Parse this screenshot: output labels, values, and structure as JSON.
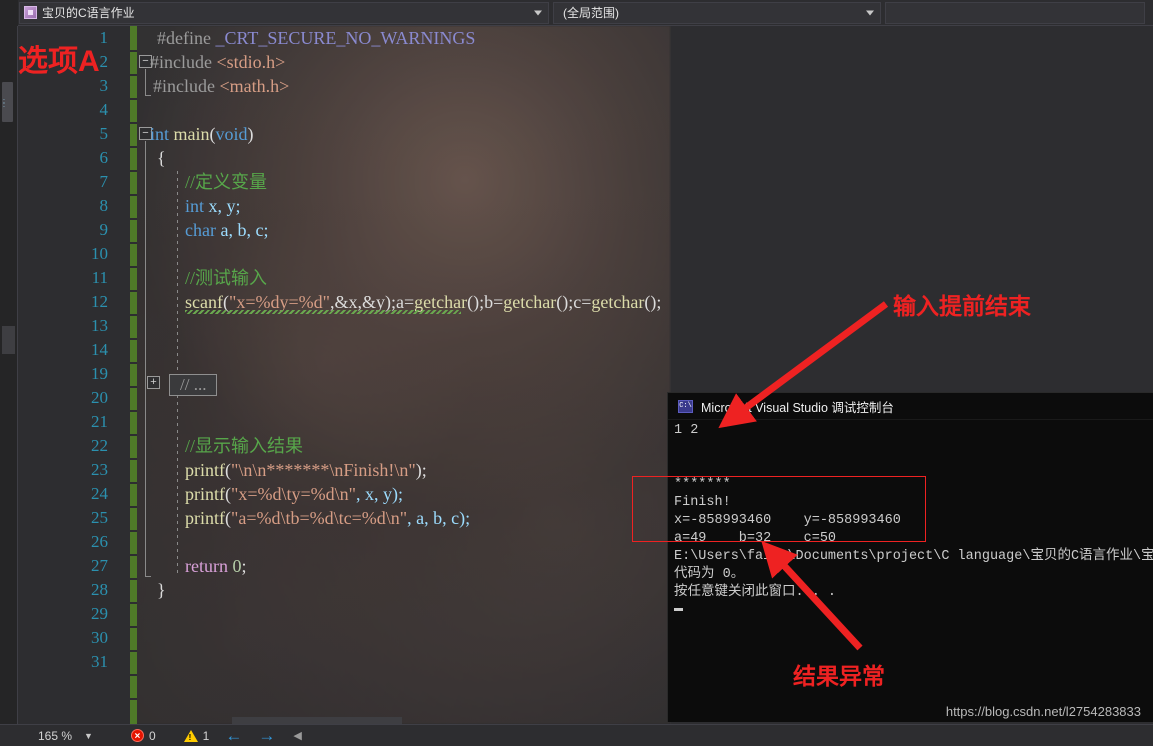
{
  "navbar": {
    "project_combo": {
      "value": "宝贝的C语言作业",
      "icon": "file-icon",
      "arrow": "chevron-down-icon"
    },
    "scope_combo": {
      "value": "(全局范围)",
      "arrow": "chevron-down-icon"
    },
    "third_combo": {
      "value": ""
    }
  },
  "editor": {
    "lines": [
      {
        "num": "1",
        "indent": 0,
        "fold": "none"
      },
      {
        "num": "2",
        "indent": 0,
        "fold": "minus"
      },
      {
        "num": "3",
        "indent": 0,
        "fold": "end"
      },
      {
        "num": "4",
        "indent": 0,
        "fold": "none"
      },
      {
        "num": "5",
        "indent": 0,
        "fold": "minus"
      },
      {
        "num": "6",
        "indent": 0,
        "fold": "none"
      },
      {
        "num": "7",
        "indent": 1,
        "fold": "none"
      },
      {
        "num": "8",
        "indent": 1,
        "fold": "none"
      },
      {
        "num": "9",
        "indent": 1,
        "fold": "none"
      },
      {
        "num": "10",
        "indent": 1,
        "fold": "none"
      },
      {
        "num": "11",
        "indent": 1,
        "fold": "none"
      },
      {
        "num": "12",
        "indent": 1,
        "fold": "none"
      },
      {
        "num": "13",
        "indent": 1,
        "fold": "none"
      },
      {
        "num": "14",
        "indent": 1,
        "fold": "plus"
      },
      {
        "num": "19",
        "indent": 1,
        "fold": "none"
      },
      {
        "num": "20",
        "indent": 1,
        "fold": "none"
      },
      {
        "num": "21",
        "indent": 1,
        "fold": "none"
      },
      {
        "num": "22",
        "indent": 1,
        "fold": "none"
      },
      {
        "num": "23",
        "indent": 1,
        "fold": "none"
      },
      {
        "num": "24",
        "indent": 1,
        "fold": "none"
      },
      {
        "num": "25",
        "indent": 1,
        "fold": "none"
      },
      {
        "num": "26",
        "indent": 0,
        "fold": "end"
      },
      {
        "num": "27",
        "indent": 0,
        "fold": "none"
      },
      {
        "num": "28",
        "indent": 0,
        "fold": "none"
      },
      {
        "num": "29",
        "indent": 0,
        "fold": "none"
      },
      {
        "num": "30",
        "indent": 0,
        "fold": "none"
      },
      {
        "num": "31",
        "indent": 0,
        "fold": "none"
      }
    ],
    "collapsed_chip": "// ...",
    "code": {
      "l1_define": "#define",
      "l1_macro": "_CRT_SECURE_NO_WARNINGS",
      "l2_include": "#include",
      "l2_header": "<stdio.h>",
      "l3_include": "#include",
      "l3_header": "<math.h>",
      "l5_type": "int",
      "l5_name": "main",
      "l5_paren_open": "(",
      "l5_void": "void",
      "l5_paren_close": ")",
      "l6_brace": "{",
      "l7_comment": "//定义变量",
      "l8_type": "int",
      "l8_rest": " x, y;",
      "l9_type": "char",
      "l9_rest": " a, b, c;",
      "l11_comment": "//测试输入",
      "l12_fn": "scanf",
      "l12_open": "(",
      "l12_str": "\"x=%dy=%d\"",
      "l12_args": ",&x,&y)",
      "l12_tail_a": ";a=",
      "l12_tail_fa": "getchar",
      "l12_tail_b": "();b=",
      "l12_tail_fb": "getchar",
      "l12_tail_c": "();c=",
      "l12_tail_fc": "getchar",
      "l12_tail_end": "();",
      "l20_comment": "//显示输入结果",
      "l21_fn": "printf",
      "l21_str": "\"\\n\\n*******\\nFinish!\\n\"",
      "l21_end": ");",
      "l22_fn": "printf",
      "l22_str": "\"x=%d\\ty=%d\\n\"",
      "l22_args": ", x, y);",
      "l23_fn": "printf",
      "l23_str": "\"a=%d\\tb=%d\\tc=%d\\n\"",
      "l23_args": ", a, b, c);",
      "l25_kw": "return",
      "l25_num": " 0",
      "l25_end": ";",
      "l26_brace": "}"
    }
  },
  "console": {
    "icon": "command-prompt-icon",
    "title": "Microsoft Visual Studio 调试控制台",
    "output": [
      "1 2",
      "",
      "",
      "*******",
      "Finish!",
      "x=-858993460    y=-858993460",
      "a=49    b=32    c=50",
      "E:\\Users\\fairy\\Documents\\project\\C language\\宝贝的C语言作业\\宝",
      "代码为 0。",
      "按任意键关闭此窗口. . ."
    ]
  },
  "annotations": {
    "option_a": "选项A",
    "input_early_end": "输入提前结束",
    "abnormal_result": "结果异常",
    "accent_color": "#ee2222"
  },
  "statusbar": {
    "zoom": "165 %",
    "zoom_arrow": "chevron-down-icon",
    "error_count": "0",
    "warning_count": "1",
    "prev_arrow": "arrow-left-icon",
    "next_arrow": "arrow-right-icon",
    "overflow_caret": "caret-left-icon"
  },
  "watermark": "https://blog.csdn.net/l2754283833"
}
